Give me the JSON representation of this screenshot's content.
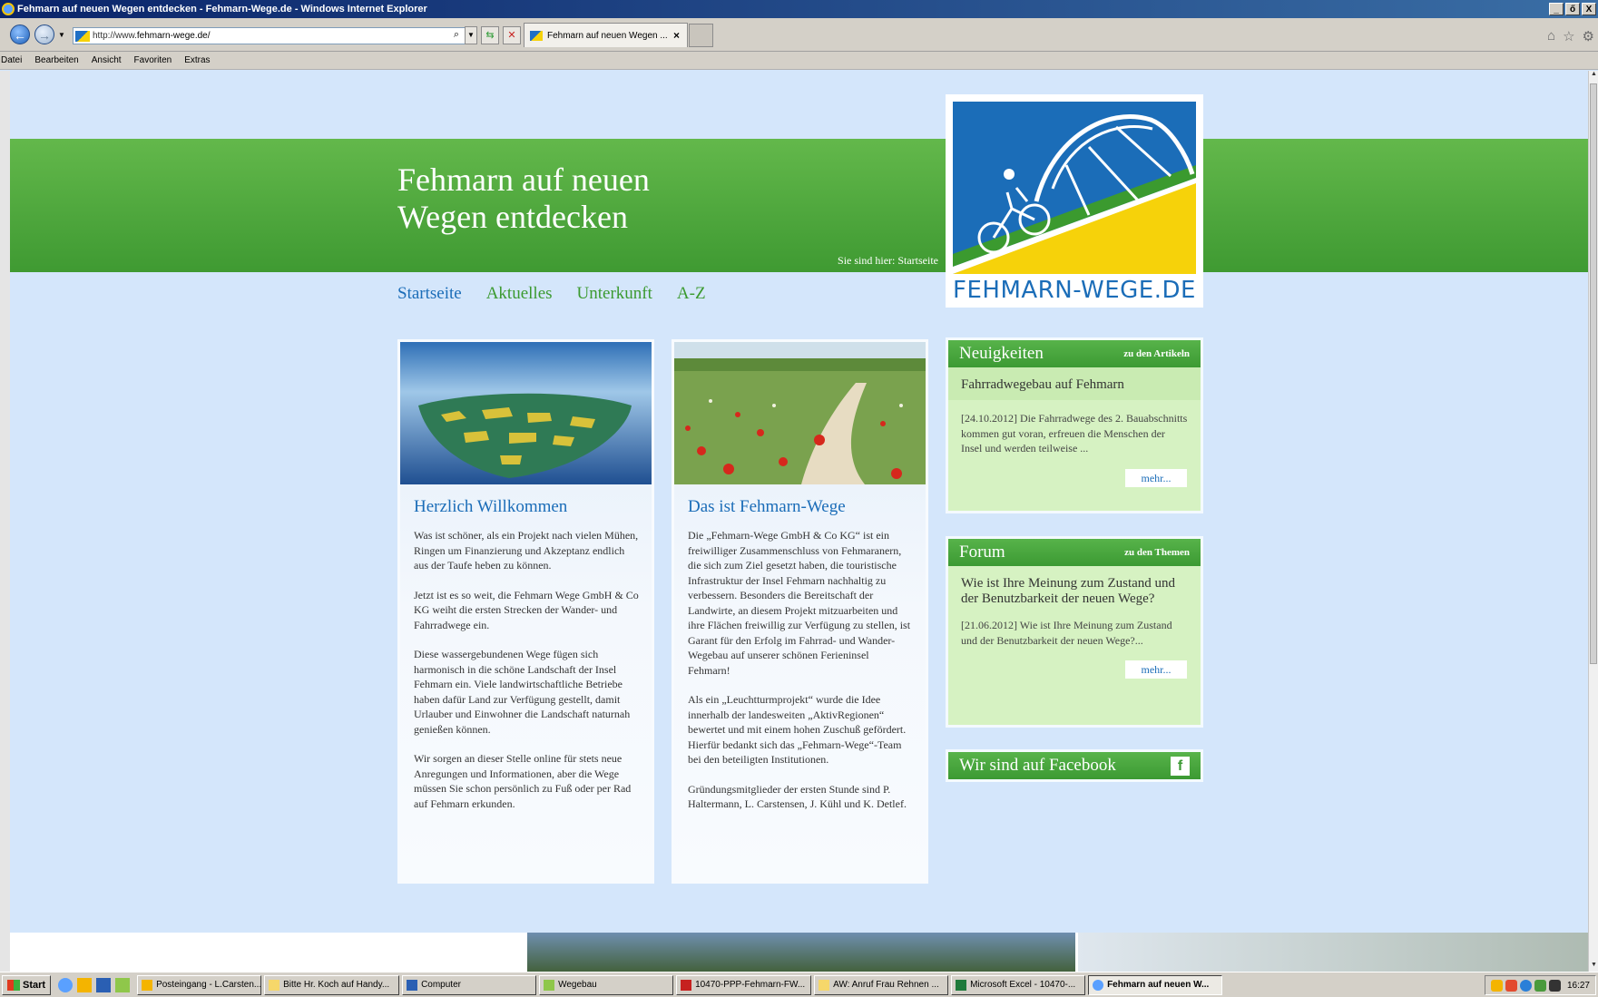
{
  "window": {
    "title": "Fehmarn auf neuen Wegen entdecken - Fehmarn-Wege.de - Windows Internet Explorer",
    "controls": [
      "_",
      "ő",
      "X"
    ]
  },
  "browser": {
    "url_prefix": "http://www.",
    "url_domain": "fehmarn-wege.de/",
    "tab_title": "Fehmarn auf neuen Wegen ...",
    "tab_close": "×",
    "menu": [
      "Datei",
      "Bearbeiten",
      "Ansicht",
      "Favoriten",
      "Extras"
    ]
  },
  "site": {
    "title_line1": "Fehmarn auf neuen",
    "title_line2": "Wegen entdecken",
    "breadcrumb": "Sie sind hier: Startseite",
    "logo_text": "FEHMARN-WEGE.DE",
    "nav": [
      {
        "label": "Startseite",
        "active": true
      },
      {
        "label": "Aktuelles",
        "active": false
      },
      {
        "label": "Unterkunft",
        "active": false
      },
      {
        "label": "A-Z",
        "active": false
      }
    ]
  },
  "col1": {
    "heading": "Herzlich Willkommen",
    "paragraphs": [
      "Was ist schöner, als ein Projekt nach vielen Mühen, Ringen um Finanzierung und Akzeptanz endlich aus der Taufe heben zu können.",
      "Jetzt ist es so weit, die Fehmarn Wege GmbH & Co KG weiht die ersten Strecken der Wander- und Fahrradwege ein.",
      "Diese wassergebundenen Wege fügen sich harmonisch in die schöne Landschaft der Insel Fehmarn ein. Viele landwirtschaftliche Betriebe haben dafür Land zur Verfügung gestellt, damit Urlauber und Einwohner die Landschaft naturnah genießen können.",
      "Wir sorgen an dieser Stelle online für stets neue Anregungen und Informationen, aber die Wege müssen Sie schon persönlich zu Fuß oder per Rad auf Fehmarn erkunden."
    ]
  },
  "col2": {
    "heading": "Das ist Fehmarn-Wege",
    "paragraphs": [
      "Die „Fehmarn-Wege GmbH & Co KG“ ist ein freiwilliger Zusammenschluss von Fehmaranern, die sich zum Ziel gesetzt haben, die touristische Infrastruktur der Insel Fehmarn nachhaltig zu verbessern. Besonders die Bereitschaft der Landwirte, an diesem Projekt mitzuarbeiten und ihre Flächen freiwillig zur Verfügung zu stellen, ist Garant für den Erfolg im Fahrrad- und Wander-Wegebau auf unserer schönen Ferieninsel Fehmarn!",
      "Als ein „Leuchtturmprojekt“ wurde die Idee innerhalb der landesweiten „AktivRegionen“ bewertet und mit einem hohen Zuschuß gefördert. Hierfür bedankt sich das „Fehmarn-Wege“-Team bei den beteiligten Institutionen.",
      "Gründungsmitglieder der ersten Stunde sind P. Haltermann, L. Carstensen, J. Kühl und K. Detlef."
    ]
  },
  "news": {
    "title": "Neuigkeiten",
    "link": "zu den Artikeln",
    "headline": "Fahrradwegebau auf Fehmarn",
    "body": "[24.10.2012] Die Fahrradwege des 2. Bauabschnitts kommen gut voran, erfreuen die Menschen der Insel und werden teilweise ...",
    "more": "mehr..."
  },
  "forum": {
    "title": "Forum",
    "link": "zu den Themen",
    "headline": "Wie ist Ihre Meinung zum Zustand und der Benutzbarkeit der neuen Wege?",
    "body": "[21.06.2012] Wie ist Ihre Meinung zum Zustand und der Benutzbarkeit der neuen Wege?...",
    "more": "mehr..."
  },
  "facebook": {
    "title": "Wir sind auf Facebook",
    "icon_letter": "f"
  },
  "taskbar": {
    "start": "Start",
    "tasks": [
      {
        "label": "Posteingang - L.Carsten...",
        "active": false
      },
      {
        "label": "Bitte Hr. Koch auf Handy...",
        "active": false
      },
      {
        "label": "Computer",
        "active": false
      },
      {
        "label": "Wegebau",
        "active": false
      },
      {
        "label": "10470-PPP-Fehmarn-FW...",
        "active": false
      },
      {
        "label": "AW: Anruf Frau Rehnen ...",
        "active": false
      },
      {
        "label": "Microsoft Excel - 10470-...",
        "active": false
      },
      {
        "label": "Fehmarn auf neuen W...",
        "active": true
      }
    ],
    "clock": "16:27"
  }
}
